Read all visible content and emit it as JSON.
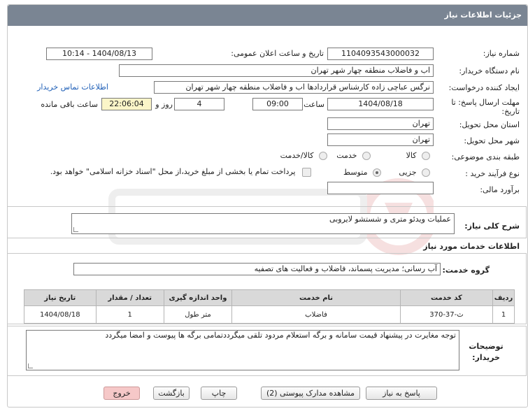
{
  "header": {
    "title": "جزئیات اطلاعات نیاز"
  },
  "form": {
    "need_number_label": "شماره نیاز:",
    "need_number": "1104093543000032",
    "announce_label": "تاریخ و ساعت اعلان عمومی:",
    "announce_value": "1404/08/13 - 10:14",
    "buyer_org_label": "نام دستگاه خریدار:",
    "buyer_org": "اب و فاضلاب منطقه چهار شهر تهران",
    "creator_label": "ایجاد کننده درخواست:",
    "creator": "نرگس عباچی زاده کارشناس قراردادها اب و فاضلاب منطقه چهار شهر تهران",
    "contact_link": "اطلاعات تماس خریدار",
    "deadline_label": "مهلت ارسال پاسخ: تا تاریخ:",
    "deadline_date": "1404/08/18",
    "time_label": "ساعت",
    "deadline_time": "09:00",
    "days_value": "4",
    "days_label": "روز و",
    "remaining_time": "22:06:04",
    "remaining_label": "ساعت باقی مانده",
    "province_label": "استان محل تحویل:",
    "province": "تهران",
    "city_label": "شهر محل تحویل:",
    "city": "تهران",
    "category_label": "طبقه بندی موضوعی:",
    "category_options": [
      "کالا",
      "خدمت",
      "کالا/خدمت"
    ],
    "process_label": "نوع فرآیند خرید :",
    "process_options": [
      "جزیی",
      "متوسط"
    ],
    "payment_note": "پرداخت تمام یا بخشی از مبلغ خرید،از محل \"اسناد خزانه اسلامی\" خواهد بود.",
    "budget_label": "برآورد مالی:",
    "budget": ""
  },
  "description": {
    "label": "شرح کلی نیاز:",
    "value": "عملیات ویدئو متری و شستشو  لایروبی"
  },
  "services": {
    "section_title": "اطلاعات خدمات مورد نیاز",
    "group_label": "گروه خدمت:",
    "group_value": "آب رسانی؛ مدیریت پسماند، فاضلاب و فعالیت های تصفیه",
    "columns": [
      "ردیف",
      "کد خدمت",
      "نام خدمت",
      "واحد اندازه گیری",
      "تعداد / مقدار",
      "تاریخ نیاز"
    ],
    "rows": [
      [
        "1",
        "ث-37-370",
        "فاضلاب",
        "متر طول",
        "1",
        "1404/08/18"
      ]
    ]
  },
  "notes": {
    "label": "توضیحات خریدار:",
    "value": "توجه مغایرت در پیشنهاد قیمت سامانه و برگه استعلام مردود تلقی میگرددتمامی برگه ها پیوست و امضا میگردد"
  },
  "buttons": {
    "reply": "پاسخ به نیاز",
    "attachments": "مشاهده مدارک پیوستی (2)",
    "print": "چاپ",
    "back": "بازگشت",
    "exit": "خروج"
  },
  "colors": {
    "header_bg": "#7a8593",
    "highlight": "#fbf5c8",
    "exit_bg": "#f6c8c8",
    "link": "#1f5fb7"
  }
}
